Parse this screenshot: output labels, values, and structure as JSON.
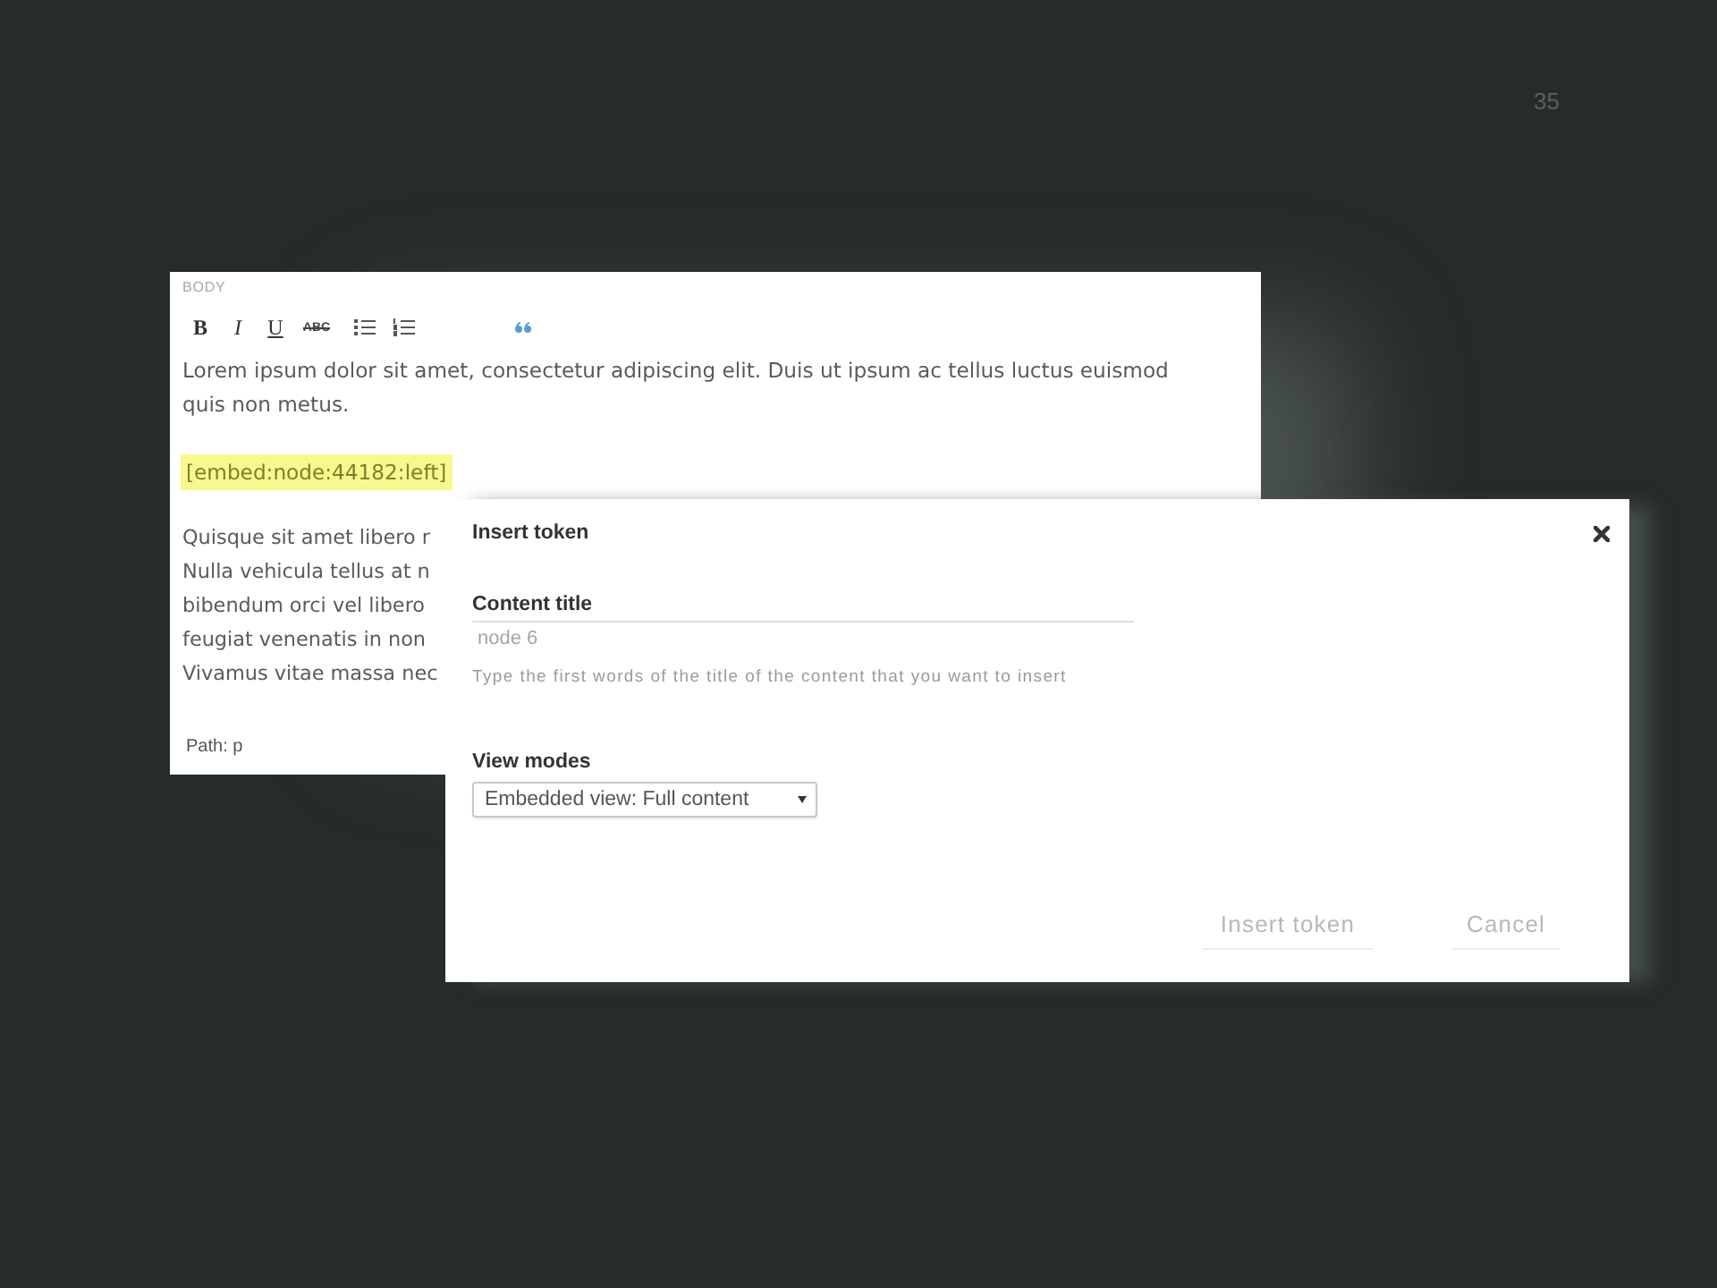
{
  "slide_number": "35",
  "editor": {
    "label": "BODY",
    "toolbar": [
      {
        "kind": "bold",
        "label": "B"
      },
      {
        "kind": "italic",
        "label": "I"
      },
      {
        "kind": "underline",
        "label": "U"
      },
      {
        "kind": "strike",
        "label": "ABC"
      },
      {
        "kind": "bullet-list"
      },
      {
        "kind": "numbered-list"
      },
      {
        "kind": "quote"
      }
    ],
    "paragraph": "Lorem ipsum dolor sit amet, consectetur adipiscing elit. Duis ut ipsum ac tellus luctus euismod quis non metus.",
    "token": "[embed:node:44182:left]",
    "covered_lines": [
      "Quisque sit amet libero r",
      "Nulla vehicula tellus at n",
      "bibendum orci vel libero",
      "feugiat venenatis in non",
      "Vivamus vitae massa nec"
    ],
    "path": "Path: p"
  },
  "dialog": {
    "title": "Insert token",
    "fields": [
      {
        "kind": "text",
        "label": "Content title",
        "value": "node 6",
        "description": "Type the first words of the title of the content that you want to insert"
      },
      {
        "kind": "select",
        "label": "View modes",
        "value": "Embedded view: Full content"
      }
    ],
    "buttons": [
      {
        "label": "Insert token"
      },
      {
        "label": "Cancel"
      }
    ]
  }
}
